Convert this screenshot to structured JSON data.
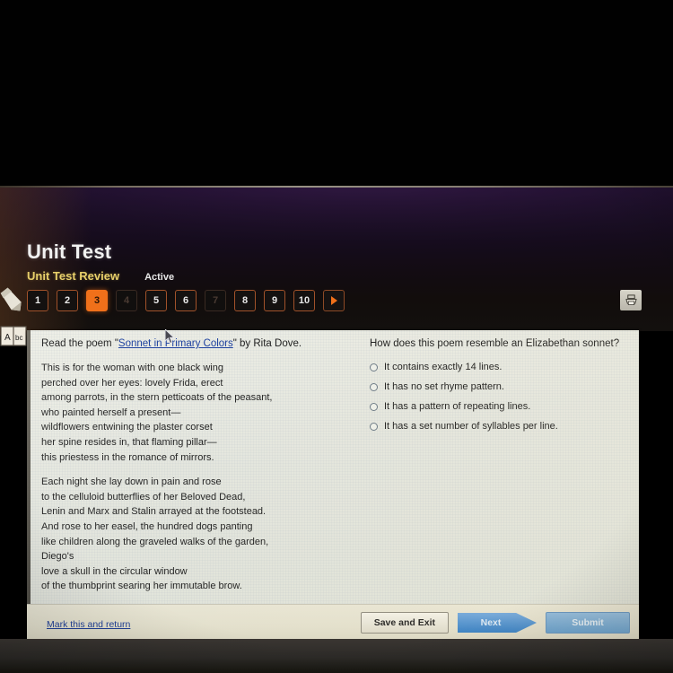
{
  "header": {
    "title": "Unit Test",
    "subtitle": "Unit Test Review",
    "status": "Active"
  },
  "question_nav": {
    "items": [
      {
        "label": "1",
        "state": "available"
      },
      {
        "label": "2",
        "state": "available"
      },
      {
        "label": "3",
        "state": "active"
      },
      {
        "label": "4",
        "state": "disabled"
      },
      {
        "label": "5",
        "state": "available"
      },
      {
        "label": "6",
        "state": "available"
      },
      {
        "label": "7",
        "state": "disabled"
      },
      {
        "label": "8",
        "state": "available"
      },
      {
        "label": "9",
        "state": "available"
      },
      {
        "label": "10",
        "state": "available"
      }
    ],
    "next_arrow": "next-arrow",
    "active_color": "#f0701a",
    "border_color": "#a1522a"
  },
  "toolbar": {
    "print_icon": "printer-icon"
  },
  "desktop_icons": {
    "pencil": "pencil-icon",
    "dictionary": "dictionary-icon"
  },
  "passage": {
    "intro_before": "Read the poem \"",
    "link_text": "Sonnet in Primary Colors",
    "intro_after": "\" by Rita Dove.",
    "stanza1": "This is for the woman with one black wing\nperched over her eyes: lovely Frida, erect\namong parrots, in the stern petticoats of the peasant,\nwho painted herself a present—\nwildflowers entwining the plaster corset\nher spine resides in, that flaming pillar—\nthis priestess in the romance of mirrors.",
    "stanza2": "Each night she lay down in pain and rose\nto the celluloid butterflies of her Beloved Dead,\nLenin and Marx and Stalin arrayed at the footstead.\nAnd rose to her easel, the hundred dogs panting\nlike children along the graveled walks of the garden,\nDiego's\nlove a skull in the circular window\nof the thumbprint searing her immutable brow."
  },
  "question": {
    "prompt": "How does this poem resemble an Elizabethan sonnet?",
    "options": [
      {
        "label": "It contains exactly 14 lines.",
        "selected": false
      },
      {
        "label": "It has no set rhyme pattern.",
        "selected": false
      },
      {
        "label": "It has a pattern of repeating lines.",
        "selected": false
      },
      {
        "label": "It has a set number of syllables per line.",
        "selected": false
      }
    ]
  },
  "footer": {
    "mark_link": "Mark this and return",
    "save_exit": "Save and Exit",
    "next": "Next",
    "submit": "Submit"
  }
}
